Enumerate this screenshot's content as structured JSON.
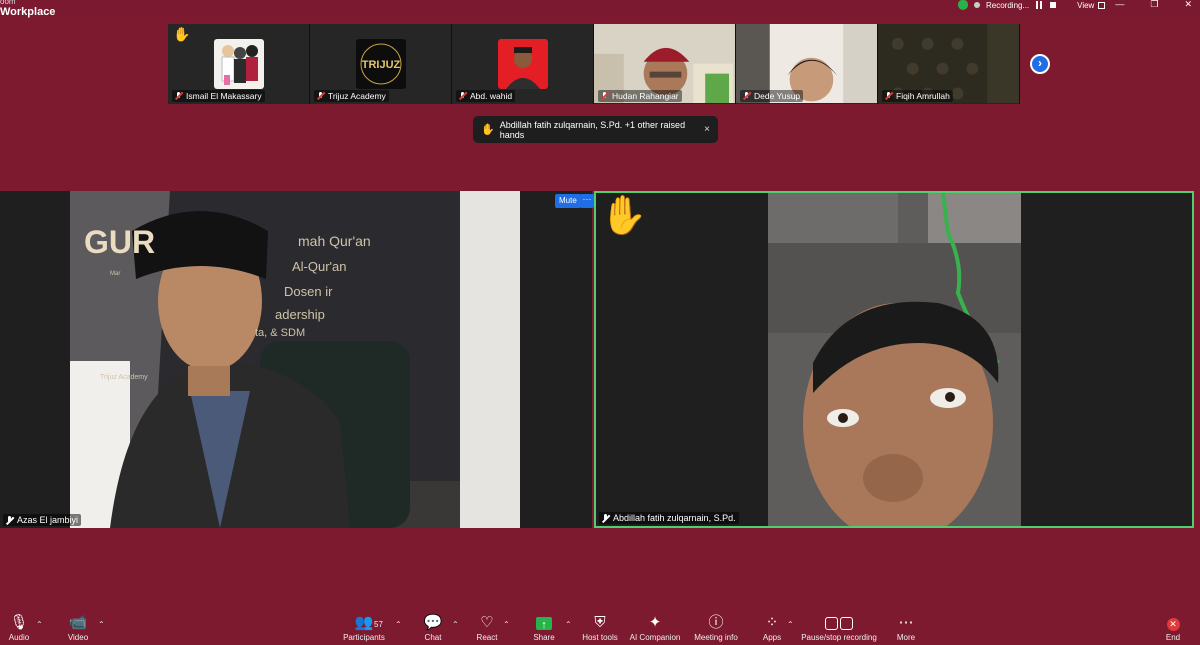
{
  "app": {
    "title_line1": "oom",
    "title_line2": "Workplace"
  },
  "recording": {
    "label": "Recording...",
    "view_label": "View"
  },
  "window_controls": [
    "—",
    "❐",
    "✕"
  ],
  "participants_strip": [
    {
      "name": "Ismail El Makassary",
      "muted": true
    },
    {
      "name": "Trijuz Academy",
      "muted": true,
      "avatar_text": "TRIJUZ"
    },
    {
      "name": "Abd. wahid",
      "muted": true
    },
    {
      "name": "Hudan Rahangiar",
      "muted": true
    },
    {
      "name": "Dede Yusup",
      "muted": true
    },
    {
      "name": "Fiqih Amrullah",
      "muted": true
    }
  ],
  "toast": {
    "text": "Abdillah fatih zulqarnain, S.Pd. +1 other raised hands",
    "close": "×"
  },
  "main_videos": {
    "left": {
      "name": "Azas El jambiyi"
    },
    "right": {
      "name": "Abdillah fatih zulqarnain, S.Pd."
    },
    "mute_label": "Mute",
    "more_label": "···"
  },
  "backdrop_text": {
    "big": "GUR",
    "line1": "mah Qur'an",
    "line2": "Al-Qur'an",
    "line3": "Dosen ir",
    "line4": "adership",
    "line5": "ta, & SDM",
    "brand": "Trijuz Academy",
    "small": "Mar"
  },
  "toolbar": {
    "audio": "Audio",
    "video": "Video",
    "participants": "Participants",
    "participants_count": "57",
    "chat": "Chat",
    "react": "React",
    "share": "Share",
    "host_tools": "Host tools",
    "ai_companion": "AI Companion",
    "meeting_info": "Meeting info",
    "apps": "Apps",
    "pause_stop": "Pause/stop recording",
    "more": "More",
    "end": "End"
  },
  "colors": {
    "background": "#7d1a30",
    "accent_blue": "#1f6ee5",
    "active_speaker": "#4fcf70",
    "hand": "#f7c12f"
  }
}
